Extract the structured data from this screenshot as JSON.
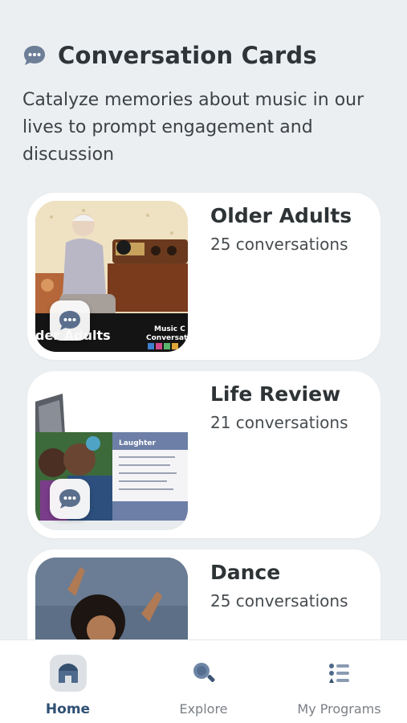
{
  "header": {
    "title": "Conversation Cards",
    "subtitle": "Catalyze memories about music in our lives to prompt engagement and discussion"
  },
  "cards": [
    {
      "title": "Older Adults",
      "count": "25 conversations",
      "thumb_text": "der Adults",
      "thumb_brand_1": "Music C",
      "thumb_brand_2": "Conversat"
    },
    {
      "title": "Life Review",
      "count": "21 conversations",
      "thumb_heading": "Laughter"
    },
    {
      "title": "Dance",
      "count": "25 conversations"
    }
  ],
  "tabs": [
    {
      "label": "Home",
      "icon": "home-icon",
      "active": true
    },
    {
      "label": "Explore",
      "icon": "search-icon",
      "active": false
    },
    {
      "label": "My Programs",
      "icon": "list-icon",
      "active": false
    }
  ],
  "colors": {
    "background": "#eceff1",
    "card": "#ffffff",
    "accent": "#2f4f73",
    "icon": "#5b6f8d"
  }
}
